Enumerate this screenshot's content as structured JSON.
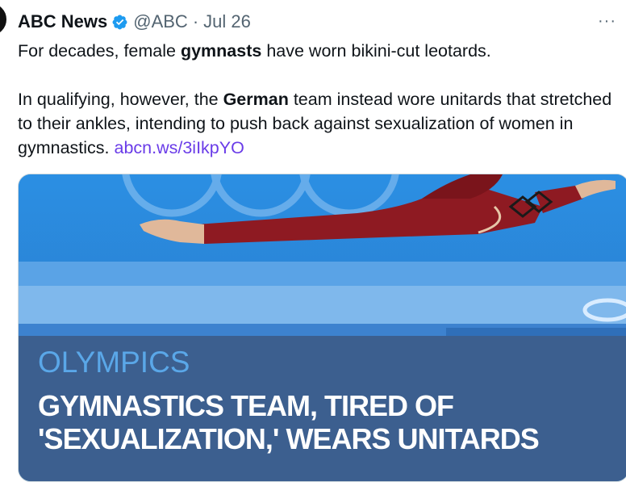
{
  "tweet": {
    "author_name": "ABC News",
    "handle": "@ABC",
    "separator": "·",
    "date": "Jul 26",
    "more_label": "···",
    "p1_before": "For decades, female ",
    "p1_bold": "gymnasts",
    "p1_after": " have worn bikini-cut leotards.",
    "p2_before": "In qualifying, however, the ",
    "p2_bold": "German",
    "p2_after": " team instead wore unitards that stretched to their ankles, intending to push back against sexualization of women in gymnastics. ",
    "link": "abcn.ws/3iIkpYO"
  },
  "card": {
    "kicker": "OLYMPICS",
    "headline_line1": "GYMNASTICS TEAM, TIRED OF",
    "headline_line2": "'SEXUALIZATION,' WEARS UNITARDS"
  },
  "colors": {
    "verified": "#1d9bf0",
    "link": "#6a3ce8",
    "overlay": "#3c5f8f",
    "kicker": "#5aa7e8",
    "unitard": "#8e1a22"
  }
}
